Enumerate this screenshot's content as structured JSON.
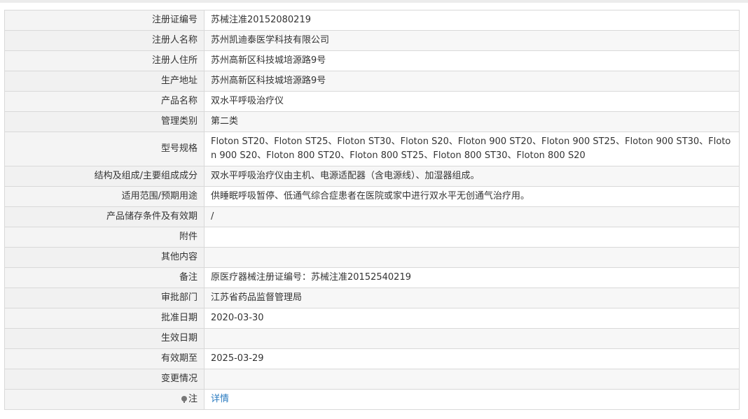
{
  "rows": [
    {
      "label": "注册证编号",
      "value": "苏械注准20152080219"
    },
    {
      "label": "注册人名称",
      "value": "苏州凯迪泰医学科技有限公司"
    },
    {
      "label": "注册人住所",
      "value": "苏州高新区科技城培源路9号"
    },
    {
      "label": "生产地址",
      "value": "苏州高新区科技城培源路9号"
    },
    {
      "label": "产品名称",
      "value": "双水平呼吸治疗仪"
    },
    {
      "label": "管理类别",
      "value": "第二类"
    },
    {
      "label": "型号规格",
      "value": "Floton ST20、Floton ST25、Floton ST30、Floton S20、Floton 900 ST20、Floton 900 ST25、Floton 900 ST30、Floton 900 S20、Floton 800 ST20、Floton 800 ST25、Floton 800 ST30、Floton 800 S20"
    },
    {
      "label": "结构及组成/主要组成成分",
      "value": "双水平呼吸治疗仪由主机、电源适配器（含电源线）、加湿器组成。"
    },
    {
      "label": "适用范围/预期用途",
      "value": "供睡眠呼吸暂停、低通气综合症患者在医院或家中进行双水平无创通气治疗用。"
    },
    {
      "label": "产品储存条件及有效期",
      "value": "/"
    },
    {
      "label": "附件",
      "value": ""
    },
    {
      "label": "其他内容",
      "value": ""
    },
    {
      "label": "备注",
      "value": "原医疗器械注册证编号：苏械注准20152540219"
    },
    {
      "label": "审批部门",
      "value": "江苏省药品监督管理局"
    },
    {
      "label": "批准日期",
      "value": "2020-03-30"
    },
    {
      "label": "生效日期",
      "value": ""
    },
    {
      "label": "有效期至",
      "value": "2025-03-29"
    },
    {
      "label": "变更情况",
      "value": ""
    }
  ],
  "note": {
    "label": "注",
    "icon": "bulb-icon",
    "link_text": "详情"
  },
  "colors": {
    "link": "#2a7bc0",
    "border": "#d9d9d9"
  }
}
